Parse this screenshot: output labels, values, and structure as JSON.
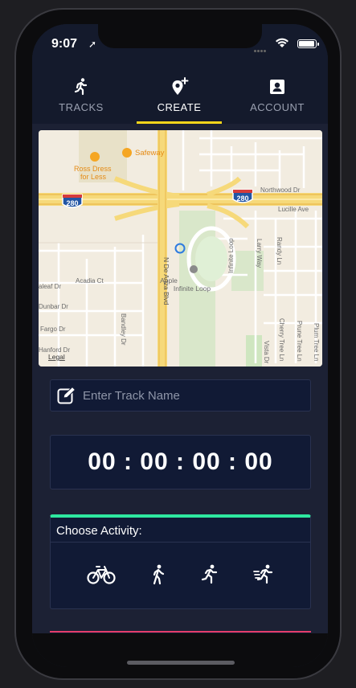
{
  "status": {
    "time": "9:07"
  },
  "tabs": [
    {
      "label": "TRACKS",
      "icon": "runner-icon",
      "active": false
    },
    {
      "label": "CREATE",
      "icon": "map-pin-plus-icon",
      "active": true
    },
    {
      "label": "ACCOUNT",
      "icon": "account-card-icon",
      "active": false
    }
  ],
  "map": {
    "labels": {
      "safeway": "Safeway",
      "ross": "Ross Dress",
      "ross2": "for Less",
      "hw280": "280",
      "northwood": "Northwood Dr",
      "lucille": "Lucille Ave",
      "acadia": "Acadia Ct",
      "leaf": "aleaf Dr",
      "dunbar": "Dunbar Dr",
      "fargo": "Fargo Dr",
      "hanford": "Hanford Dr",
      "deanza": "N De Anza Blvd",
      "apple": "Apple",
      "infinite": "Infinite Loop",
      "infiniteloop": "Infinite Loop",
      "larry": "Larry Way",
      "randy": "Randy Ln",
      "bandley": "Bandley Dr",
      "cherry": "Cherry Tree Ln",
      "prune": "Prune Tree Ln",
      "plum": "Plum Tree Ln",
      "vista": "Vista Dr",
      "legal": "Legal"
    }
  },
  "track_name": {
    "placeholder": "Enter Track Name",
    "value": ""
  },
  "timer": {
    "display": "00 : 00 : 00 : 00"
  },
  "activity": {
    "title": "Choose Activity:",
    "options": [
      "bike-icon",
      "walk-icon",
      "run-icon",
      "sprint-icon"
    ]
  },
  "colors": {
    "accent_tab": "#f7d51b",
    "activity_accent": "#2ee8a0",
    "bottom_accent": "#e63d6a",
    "panel": "#111a35"
  }
}
